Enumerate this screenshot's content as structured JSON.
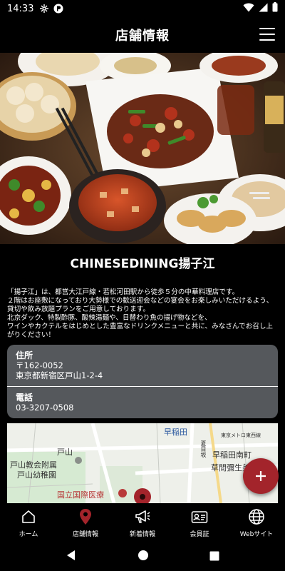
{
  "status_bar": {
    "time": "14:33"
  },
  "header": {
    "title": "店舗情報",
    "menu_icon": "hamburger-menu-icon"
  },
  "hero": {
    "image": "food-photo"
  },
  "shop": {
    "name": "CHINESEDINING揚子江",
    "description": "「揚子江」は、都営大江戸線・若松河田駅から徒歩５分の中華料理店です。\n２階はお座敷になっており大勢様での歓送迎会などの宴会をお楽しみいただけるよう、貸切や飲み放題プランをご用意しております。\n北京ダック、特製酢豚、酸辣湯麺や、日替わり魚の揚げ物などを、\nワインやカクテルをはじめとした豊富なドリンクメニューと共に、みなさんでお召し上がりください！"
  },
  "info": {
    "address_label": "住所",
    "postal": "〒162-0052",
    "address": "東京都新宿区戸山1-2-4",
    "phone_label": "電話",
    "phone": "03-3207-0508"
  },
  "map": {
    "labels": {
      "waseda": "早稲田",
      "toyama": "戸山",
      "kyokai": "戸山教会附属",
      "yochien": "戸山幼稚園",
      "waseda_minami": "早稲田南町",
      "sougen": "草間彌生美",
      "hospital": "国立国際医療",
      "tozai": "東京メトロ東西線",
      "natsume": "夏目坂"
    }
  },
  "fab": {
    "label": "+"
  },
  "bottom_nav": [
    {
      "label": "ホーム",
      "icon": "home-icon"
    },
    {
      "label": "店舗情報",
      "icon": "map-pin-icon",
      "active": true
    },
    {
      "label": "新着情報",
      "icon": "megaphone-icon"
    },
    {
      "label": "会員証",
      "icon": "member-card-icon"
    },
    {
      "label": "Webサイト",
      "icon": "globe-icon"
    }
  ],
  "colors": {
    "accent": "#a3242b",
    "card": "#55585c",
    "background": "#000000"
  }
}
